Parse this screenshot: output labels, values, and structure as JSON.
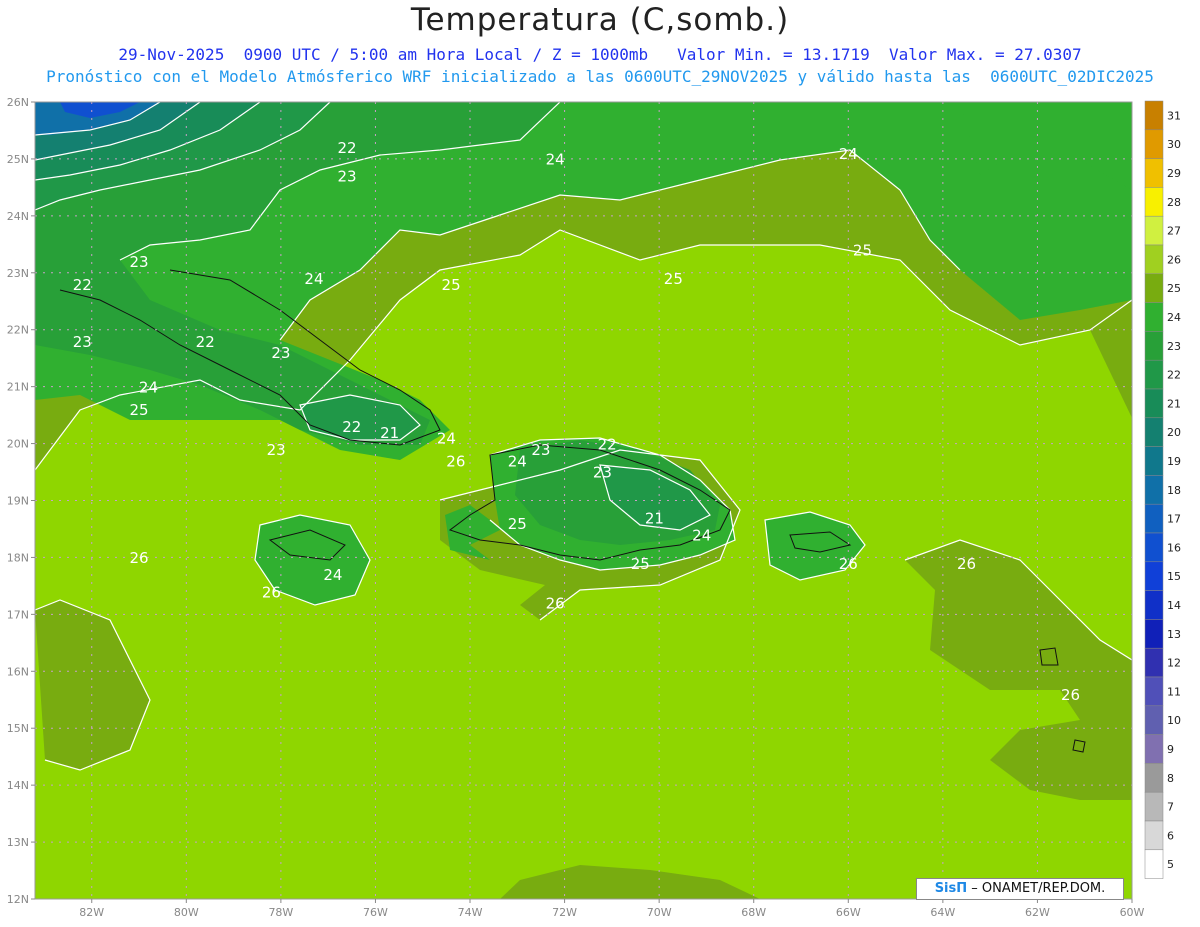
{
  "title": "Temperatura (C,somb.)",
  "subtitle_1": "29-Nov-2025  0900 UTC / 5:00 am Hora Local / Z = 1000mb   Valor Min. = 13.1719  Valor Max. = 27.0307",
  "subtitle_2": "Pronóstico con el Modelo Atmósferico WRF inicializado a las 0600UTC_29NOV2025 y válido hasta las  0600UTC_02DIC2025",
  "lat_ticks": [
    "26N",
    "25N",
    "24N",
    "23N",
    "22N",
    "21N",
    "20N",
    "19N",
    "18N",
    "17N",
    "16N",
    "15N",
    "14N",
    "13N",
    "12N"
  ],
  "lon_ticks": [
    "82W",
    "80W",
    "78W",
    "76W",
    "74W",
    "72W",
    "70W",
    "68W",
    "66W",
    "64W",
    "62W",
    "60W"
  ],
  "colorbar": {
    "levels": [
      "31",
      "30",
      "29",
      "28",
      "27",
      "26",
      "25",
      "24",
      "23",
      "22",
      "21",
      "20",
      "19",
      "18",
      "17",
      "16",
      "15",
      "14",
      "13",
      "12",
      "11",
      "10",
      "9",
      "8",
      "7",
      "6",
      "5"
    ],
    "colors": [
      "#c88000",
      "#e09a00",
      "#f0c000",
      "#f8f000",
      "#d0f040",
      "#a0d020",
      "#78ac10",
      "#30b030",
      "#28a038",
      "#209848",
      "#188c58",
      "#148070",
      "#10788c",
      "#1070a8",
      "#1060c0",
      "#1050d0",
      "#1040d8",
      "#1030c8",
      "#1020b8",
      "#3030b0",
      "#5050b8",
      "#6060b0",
      "#8070b0",
      "#9a9a9a",
      "#b8b8b8",
      "#d8d8d8",
      "#ffffff"
    ]
  },
  "contour_labels": [
    {
      "text": "22",
      "lon": -76.6,
      "lat": 25.1
    },
    {
      "text": "23",
      "lon": -76.6,
      "lat": 24.6
    },
    {
      "text": "24",
      "lon": -72.2,
      "lat": 24.9
    },
    {
      "text": "24",
      "lon": -66.0,
      "lat": 25.0
    },
    {
      "text": "23",
      "lon": -81.0,
      "lat": 23.1
    },
    {
      "text": "24",
      "lon": -77.3,
      "lat": 22.8
    },
    {
      "text": "25",
      "lon": -74.4,
      "lat": 22.7
    },
    {
      "text": "25",
      "lon": -69.7,
      "lat": 22.8
    },
    {
      "text": "25",
      "lon": -65.7,
      "lat": 23.3
    },
    {
      "text": "22",
      "lon": -82.2,
      "lat": 22.7
    },
    {
      "text": "23",
      "lon": -82.2,
      "lat": 21.7
    },
    {
      "text": "22",
      "lon": -79.6,
      "lat": 21.7
    },
    {
      "text": "23",
      "lon": -78.0,
      "lat": 21.5
    },
    {
      "text": "24",
      "lon": -80.8,
      "lat": 20.9
    },
    {
      "text": "25",
      "lon": -81.0,
      "lat": 20.5
    },
    {
      "text": "22",
      "lon": -76.5,
      "lat": 20.2
    },
    {
      "text": "21",
      "lon": -75.7,
      "lat": 20.1
    },
    {
      "text": "24",
      "lon": -74.5,
      "lat": 20.0
    },
    {
      "text": "23",
      "lon": -78.1,
      "lat": 19.8
    },
    {
      "text": "26",
      "lon": -74.3,
      "lat": 19.6
    },
    {
      "text": "24",
      "lon": -73.0,
      "lat": 19.6
    },
    {
      "text": "23",
      "lon": -72.5,
      "lat": 19.8
    },
    {
      "text": "22",
      "lon": -71.1,
      "lat": 19.9
    },
    {
      "text": "23",
      "lon": -71.2,
      "lat": 19.4
    },
    {
      "text": "21",
      "lon": -70.1,
      "lat": 18.6
    },
    {
      "text": "25",
      "lon": -73.0,
      "lat": 18.5
    },
    {
      "text": "24",
      "lon": -69.1,
      "lat": 18.3
    },
    {
      "text": "25",
      "lon": -70.4,
      "lat": 17.8
    },
    {
      "text": "26",
      "lon": -66.0,
      "lat": 17.8
    },
    {
      "text": "26",
      "lon": -63.5,
      "lat": 17.8
    },
    {
      "text": "26",
      "lon": -81.0,
      "lat": 17.9
    },
    {
      "text": "24",
      "lon": -76.9,
      "lat": 17.6
    },
    {
      "text": "26",
      "lon": -78.2,
      "lat": 17.3
    },
    {
      "text": "26",
      "lon": -72.2,
      "lat": 17.1
    },
    {
      "text": "26",
      "lon": -61.3,
      "lat": 15.5
    }
  ],
  "credit": {
    "logo": "SisΠ",
    "text": "– ONAMET/REP.DOM."
  }
}
